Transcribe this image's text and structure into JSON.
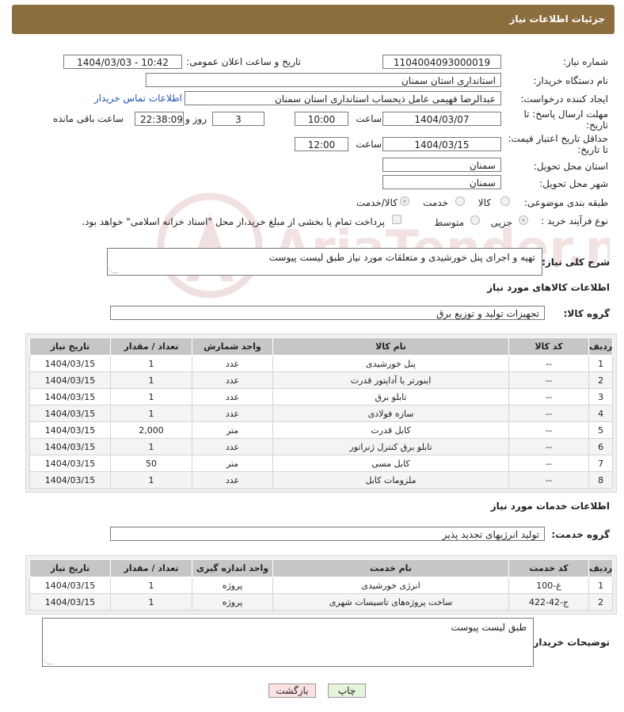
{
  "header": {
    "title": "جزئیات اطلاعات نیاز"
  },
  "form": {
    "need_number_label": "شماره نیاز:",
    "need_number": "1104004093000019",
    "announce_label": "تاریخ و ساعت اعلان عمومی:",
    "announce_value": "1404/03/03 - 10:42",
    "buyer_label": "نام دستگاه خریدار:",
    "buyer_value": "استانداری استان سمنان",
    "creator_label": "ایجاد کننده درخواست:",
    "creator_value": "عبدالرضا فهیمی عامل ذیحساب استانداری استان سمنان",
    "contact_link": "اطلاعات تماس خریدار",
    "deadline_label_1": "مهلت ارسال پاسخ: تا",
    "deadline_label_2": "تاریخ:",
    "deadline_date": "1404/03/07",
    "time_label": "ساعت",
    "deadline_time": "10:00",
    "days_value": "3",
    "days_label": "روز و",
    "remaining_time": "22:38:09",
    "remaining_label": "ساعت باقی مانده",
    "price_label_1": "حداقل تاریخ اعتبار قیمت:",
    "price_label_2": "تا تاریخ:",
    "price_date": "1404/03/15",
    "price_time": "12:00",
    "province_label": "استان محل تحویل:",
    "province_value": "سمنان",
    "city_label": "شهر محل تحویل:",
    "city_value": "سمنان",
    "category_label": "طبقه بندی موضوعی:",
    "category_options": [
      "کالا",
      "خدمت",
      "کالا/خدمت"
    ],
    "process_label": "نوع فرآیند خرید :",
    "process_options": [
      "جزیی",
      "متوسط"
    ],
    "payment_note": "پرداخت تمام یا بخشی از مبلغ خرید،از محل \"اسناد خزانه اسلامی\" خواهد بود."
  },
  "summary": {
    "label": "شرح کلی نیاز:",
    "value": "تهیه و اجرای پنل خورشیدی و متعلقات مورد نیاز طبق لیست پیوست"
  },
  "goods": {
    "section_title": "اطلاعات کالاهای مورد نیاز",
    "group_label": "گروه کالا:",
    "group_value": "تجهیزات تولید و توزیع برق",
    "headers": [
      "ردیف",
      "کد کالا",
      "نام کالا",
      "واحد شمارش",
      "تعداد / مقدار",
      "تاریخ نیاز"
    ],
    "rows": [
      [
        "1",
        "--",
        "پنل خورشیدی",
        "عدد",
        "1",
        "1404/03/15"
      ],
      [
        "2",
        "--",
        "اینورتر یا آداپتور قدرت",
        "عدد",
        "1",
        "1404/03/15"
      ],
      [
        "3",
        "--",
        "تابلو برق",
        "عدد",
        "1",
        "1404/03/15"
      ],
      [
        "4",
        "--",
        "سازه فولادی",
        "عدد",
        "1",
        "1404/03/15"
      ],
      [
        "5",
        "--",
        "کابل قدرت",
        "متر",
        "2,000",
        "1404/03/15"
      ],
      [
        "6",
        "--",
        "تابلو برق کنترل ژنراتور",
        "عدد",
        "1",
        "1404/03/15"
      ],
      [
        "7",
        "--",
        "کابل مسی",
        "متر",
        "50",
        "1404/03/15"
      ],
      [
        "8",
        "--",
        "ملزومات کابل",
        "عدد",
        "1",
        "1404/03/15"
      ]
    ]
  },
  "services": {
    "section_title": "اطلاعات خدمات مورد نیاز",
    "group_label": "گروه خدمت:",
    "group_value": "تولید انرژیهای تجدید پذیر",
    "headers": [
      "ردیف",
      "کد خدمت",
      "نام خدمت",
      "واحد اندازه گیری",
      "تعداد / مقدار",
      "تاریخ نیاز"
    ],
    "rows": [
      [
        "1",
        "غ-100",
        "انرژی خورشیدی",
        "پروژه",
        "1",
        "1404/03/15"
      ],
      [
        "2",
        "ج-42-422",
        "ساخت پروژه‌های تاسیسات شهری",
        "پروژه",
        "1",
        "1404/03/15"
      ]
    ]
  },
  "buyer_notes": {
    "label": "توضیحات خریدار:",
    "value": "طبق لیست پیوست"
  },
  "buttons": {
    "print": "چاپ",
    "back": "بازگشت"
  },
  "watermark": {
    "text": "AriaTender.neT"
  }
}
